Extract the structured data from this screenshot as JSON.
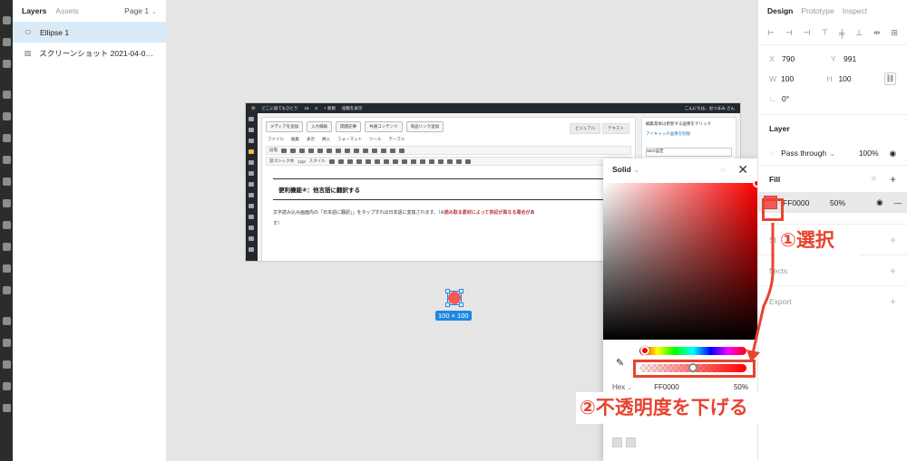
{
  "layers_panel": {
    "tab_layers": "Layers",
    "tab_assets": "Assets",
    "page": "Page 1",
    "layers": [
      {
        "icon": "ellipse-icon",
        "name": "Ellipse 1"
      },
      {
        "icon": "image-icon",
        "name": "スクリーンショット 2021-04-03 8...."
      }
    ]
  },
  "canvas": {
    "selection_size": "100 × 100",
    "screenshot": {
      "adminbar_items": [
        "どこに居てもひとり",
        "18",
        "0",
        "+ 新規",
        "投稿を表示"
      ],
      "adminbar_right": "こんにちは、おつまみ さん",
      "media_buttons": [
        "メディアを追加",
        "入力補助",
        "関連記事",
        "共通コンテンツ",
        "商品リンク追加"
      ],
      "editor_tabs": [
        "ビジュアル",
        "テキスト"
      ],
      "menu": [
        "ファイル",
        "編集",
        "表示",
        "挿入",
        "フォーマット",
        "ツール",
        "テーブル"
      ],
      "toolbar_1_left": "段落",
      "toolbar_2_left": "游ゴシック体",
      "toolbar_2_size": "12pt",
      "toolbar_2_style": "スタイル",
      "heading": "便利機能④：他言語に翻訳する",
      "body_before": "文字読み込み画面内の「",
      "body_mid": "日本語に翻訳」」をタップすれば日本語に変換されます。（※",
      "body_bold": "読み取る素材によって表記が異なる場合があ",
      "body_end": "す）",
      "sidebar_text": "編集基本は更新する画像をクリック",
      "sidebar_link": "アイキャッチ画像を削除",
      "sidebar_box": "SEO設定"
    }
  },
  "color_picker": {
    "mode": "Solid",
    "hex_label": "Hex",
    "hex_value": "FF0000",
    "alpha_value": "50%",
    "hue_position": 0.0,
    "alpha_level": 0.5
  },
  "properties": {
    "tabs": [
      "Design",
      "Prototype",
      "Inspect"
    ],
    "x_label": "X",
    "x_value": "790",
    "y_label": "Y",
    "y_value": "991",
    "w_label": "W",
    "w_value": "100",
    "h_label": "H",
    "h_value": "100",
    "rotation": "0°",
    "layer_title": "Layer",
    "blend_mode": "Pass through",
    "layer_opacity": "100%",
    "fill_title": "Fill",
    "fill_hex": "FF0000",
    "fill_opacity": "50%",
    "stroke_title": "St",
    "effects_title": "ffects",
    "export_title": "Export"
  },
  "annotations": {
    "step1": "①選択",
    "step2": "②不透明度を下げる",
    "color": "#e8442f"
  },
  "colors": {
    "fill_swatch": "#f05a5a",
    "selection": "#1e88e5",
    "layer_selected_bg": "#daebf7"
  }
}
